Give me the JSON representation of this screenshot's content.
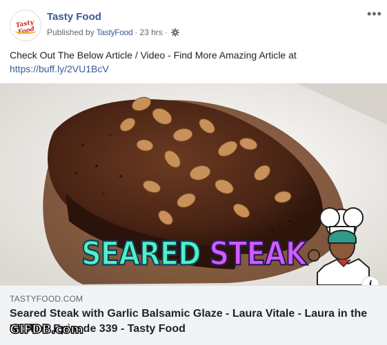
{
  "post": {
    "page_name": "Tasty Food",
    "published_by_prefix": "Published by",
    "publisher": "TastyFood",
    "separator": "·",
    "time": "23 hrs",
    "text": "Check Out The Below Article / Video - Find More Amazing Article at",
    "link": "https://buff.ly/2VU1BcV",
    "more_icon": "ellipsis-icon",
    "audience_icon": "gear-icon"
  },
  "avatar": {
    "logo_text": "Tasty Food"
  },
  "media": {
    "caption_word_1": "SEARED",
    "caption_word_2": "STEAK",
    "caption_colors": {
      "word_1": "#4ef2c4",
      "word_2": "#d35bff"
    },
    "info_icon": "i"
  },
  "preview": {
    "domain": "TASTYFOOD.COM",
    "headline": "Seared Steak with Garlic Balsamic Glaze - Laura Vitale - Laura in the Kitchen Episode 339 - Tasty Food"
  },
  "watermark": {
    "text": "GIFDB.com"
  },
  "colors": {
    "link": "#385898",
    "meta": "#616770",
    "preview_bg": "#f2f3f5"
  }
}
